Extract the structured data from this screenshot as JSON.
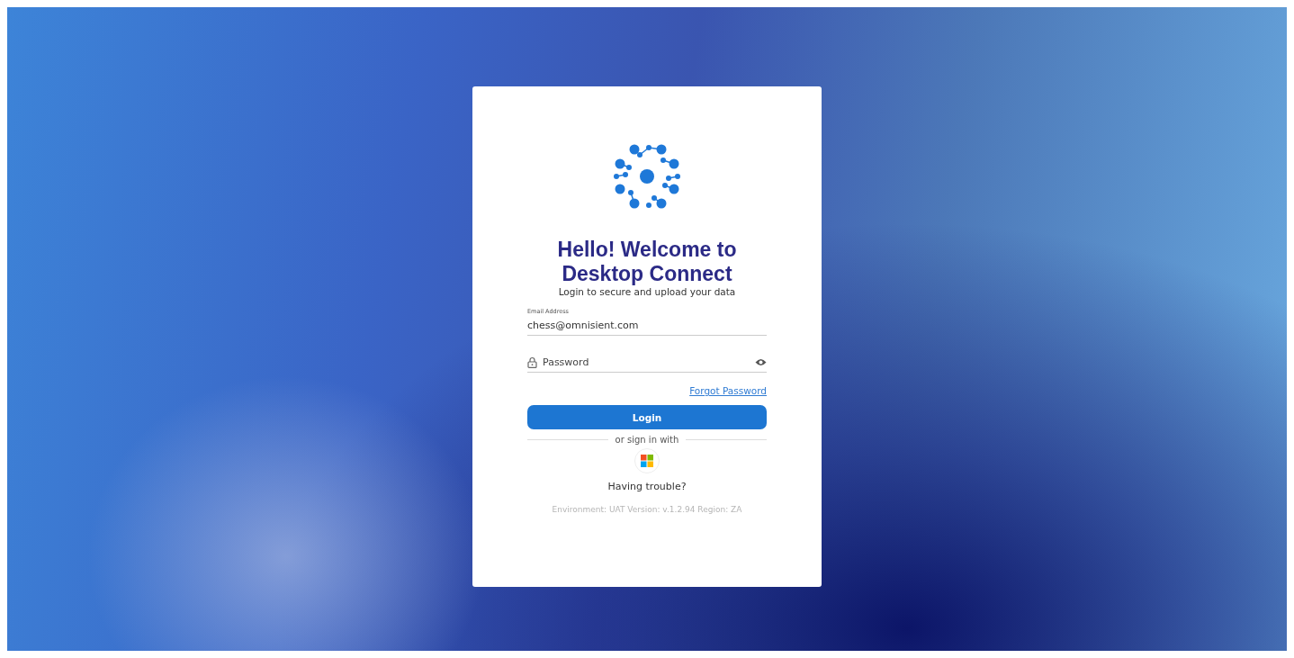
{
  "card": {
    "heading_line_1": "Hello! Welcome to",
    "heading_line_2": "Desktop Connect",
    "subtitle": "Login to secure and upload your data"
  },
  "email": {
    "label": "Email Address",
    "value": "chess@omnisient.com"
  },
  "password": {
    "placeholder": "Password"
  },
  "forgot_link": "Forgot Password",
  "login_button": "Login",
  "divider_text": "or sign in with",
  "help_text": "Having trouble?",
  "footer": "Environment: UAT Version: v.1.2.94 Region: ZA"
}
